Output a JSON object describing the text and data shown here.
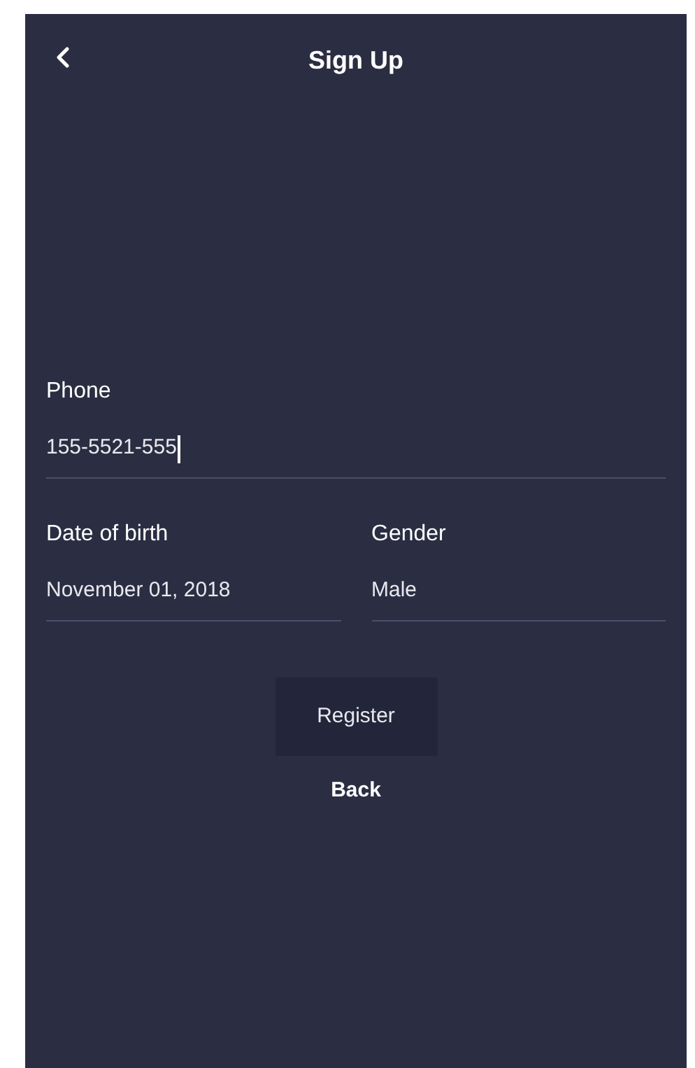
{
  "header": {
    "title": "Sign Up"
  },
  "phone": {
    "label": "Phone",
    "value": "155-5521-555",
    "focused": true
  },
  "row_fields": [
    {
      "label": "Date of birth",
      "value": "November 01, 2018",
      "focused": false
    },
    {
      "label": "Gender",
      "value": "Male",
      "focused": false
    }
  ],
  "buttons": [
    {
      "kind": "filled",
      "label": "Register"
    },
    {
      "kind": "text",
      "label": "Back"
    }
  ]
}
